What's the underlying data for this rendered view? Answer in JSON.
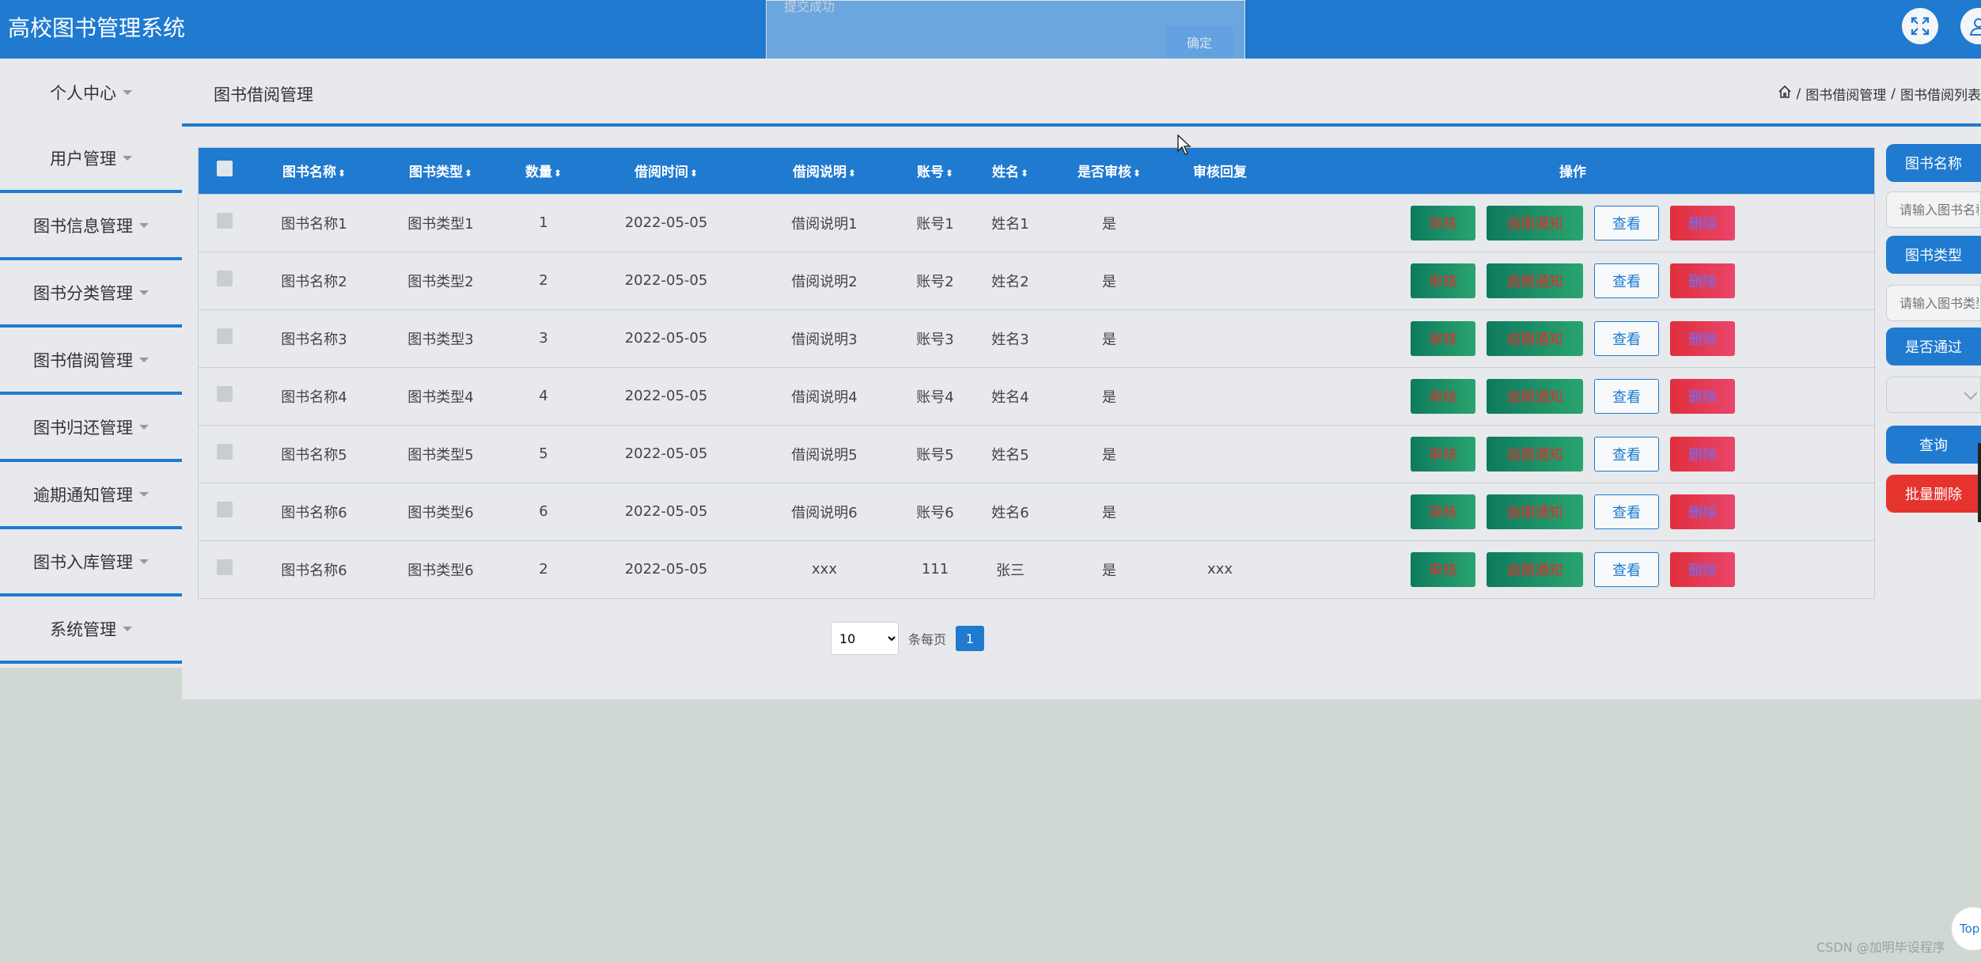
{
  "app": {
    "title": "高校图书管理系统"
  },
  "dialog": {
    "text": "提交成功",
    "ok_label": "确定"
  },
  "sidebar": {
    "items": [
      {
        "label": "个人中心"
      },
      {
        "label": "用户管理"
      },
      {
        "label": "图书信息管理"
      },
      {
        "label": "图书分类管理"
      },
      {
        "label": "图书借阅管理"
      },
      {
        "label": "图书归还管理"
      },
      {
        "label": "逾期通知管理"
      },
      {
        "label": "图书入库管理"
      },
      {
        "label": "系统管理"
      }
    ]
  },
  "page": {
    "title": "图书借阅管理",
    "breadcrumb": {
      "sep": "/",
      "item1": "图书借阅管理",
      "item2": "图书借阅列表"
    }
  },
  "table": {
    "columns": [
      "图书名称",
      "图书类型",
      "数量",
      "借阅时间",
      "借阅说明",
      "账号",
      "姓名",
      "是否审核",
      "审核回复",
      "操作"
    ],
    "sort_glyph": "⬍",
    "rows": [
      {
        "name": "图书名称1",
        "type": "图书类型1",
        "qty": "1",
        "time": "2022-05-05",
        "desc": "借阅说明1",
        "account": "账号1",
        "person": "姓名1",
        "audited": "是",
        "reply": ""
      },
      {
        "name": "图书名称2",
        "type": "图书类型2",
        "qty": "2",
        "time": "2022-05-05",
        "desc": "借阅说明2",
        "account": "账号2",
        "person": "姓名2",
        "audited": "是",
        "reply": ""
      },
      {
        "name": "图书名称3",
        "type": "图书类型3",
        "qty": "3",
        "time": "2022-05-05",
        "desc": "借阅说明3",
        "account": "账号3",
        "person": "姓名3",
        "audited": "是",
        "reply": ""
      },
      {
        "name": "图书名称4",
        "type": "图书类型4",
        "qty": "4",
        "time": "2022-05-05",
        "desc": "借阅说明4",
        "account": "账号4",
        "person": "姓名4",
        "audited": "是",
        "reply": ""
      },
      {
        "name": "图书名称5",
        "type": "图书类型5",
        "qty": "5",
        "time": "2022-05-05",
        "desc": "借阅说明5",
        "account": "账号5",
        "person": "姓名5",
        "audited": "是",
        "reply": ""
      },
      {
        "name": "图书名称6",
        "type": "图书类型6",
        "qty": "6",
        "time": "2022-05-05",
        "desc": "借阅说明6",
        "account": "账号6",
        "person": "姓名6",
        "audited": "是",
        "reply": ""
      },
      {
        "name": "图书名称6",
        "type": "图书类型6",
        "qty": "2",
        "time": "2022-05-05",
        "desc": "xxx",
        "account": "111",
        "person": "张三",
        "audited": "是",
        "reply": "xxx"
      }
    ],
    "actions": {
      "audit": "审核",
      "overdue": "逾期通知",
      "view": "查看",
      "delete": "删除"
    }
  },
  "pager": {
    "page_size": "10",
    "per_page_label": "条每页",
    "current_page": "1"
  },
  "filter": {
    "name_label": "图书名称",
    "name_placeholder": "请输入图书名称",
    "type_label": "图书类型",
    "type_placeholder": "请输入图书类型",
    "passed_label": "是否通过",
    "query_label": "查询",
    "batch_delete_label": "批量删除"
  },
  "misc": {
    "top_label": "Top",
    "watermark": "CSDN @加明毕设程序"
  },
  "colors": {
    "primary": "#1f7ad0",
    "success": "#2aa46f",
    "danger": "#e5332e"
  }
}
